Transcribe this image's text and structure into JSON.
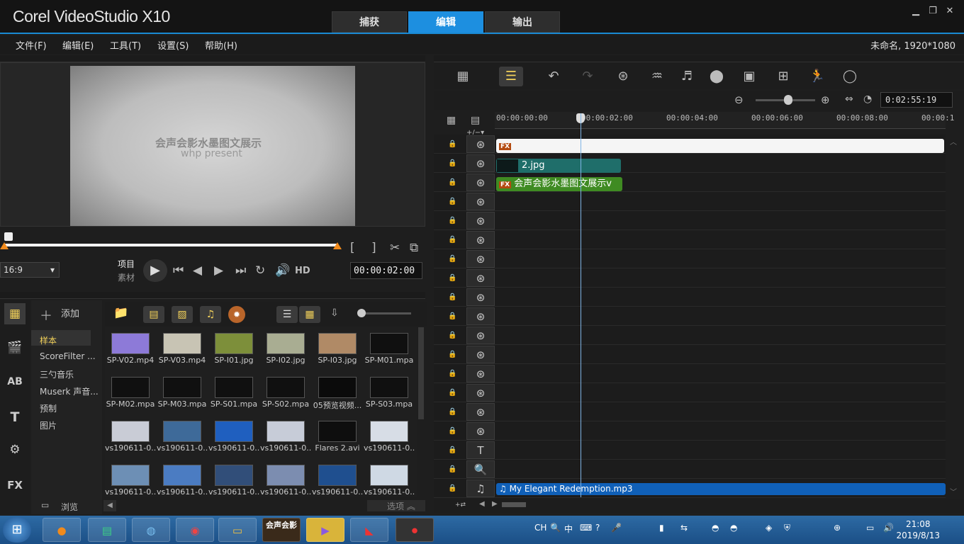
{
  "app": {
    "logo": "Corel VideoStudio X10",
    "mode_tabs": [
      "捕获",
      "编辑",
      "输出"
    ],
    "active_mode": "编辑",
    "window_controls": [
      "minimize-icon",
      "restore-icon",
      "close-icon"
    ]
  },
  "menu": {
    "items": [
      "文件(F)",
      "编辑(E)",
      "工具(T)",
      "设置(S)",
      "帮助(H)"
    ],
    "project_info": "未命名, 1920*1080"
  },
  "preview": {
    "overlay_line1": "会声会影水墨图文展示",
    "overlay_line2": "whp present",
    "aspect": "16:9",
    "mode_project": "项目",
    "mode_clip": "素材",
    "hd_label": "HD",
    "timecode": "00:00:02:00"
  },
  "library": {
    "add_label": "添加",
    "folders": [
      "样本",
      "ScoreFilter ...",
      "三勺音乐",
      "Muserk 声音...",
      "预制",
      "图片"
    ],
    "active_folder": "样本",
    "browse_label": "浏览",
    "options_label": "选项",
    "side_icons": [
      "media-icon",
      "instant-project-icon",
      "title-icon",
      "text-icon",
      "transition-icon",
      "fx-icon"
    ],
    "side_icon_text": {
      "ab": "AB",
      "t": "T",
      "fx": "FX"
    },
    "items": [
      {
        "name": "SP-V02.mp4",
        "color": "#8d7ad8"
      },
      {
        "name": "SP-V03.mp4",
        "color": "#c8c4b4"
      },
      {
        "name": "SP-I01.jpg",
        "color": "#7d8f3a"
      },
      {
        "name": "SP-I02.jpg",
        "color": "#a9ad92"
      },
      {
        "name": "SP-I03.jpg",
        "color": "#b08a66"
      },
      {
        "name": "SP-M01.mpa",
        "color": "#101010"
      },
      {
        "name": "SP-M02.mpa",
        "color": "#101010"
      },
      {
        "name": "SP-M03.mpa",
        "color": "#101010"
      },
      {
        "name": "SP-S01.mpa",
        "color": "#101010"
      },
      {
        "name": "SP-S02.mpa",
        "color": "#101010"
      },
      {
        "name": "05预览视频...",
        "color": "#0b0b0b"
      },
      {
        "name": "SP-S03.mpa",
        "color": "#101010"
      },
      {
        "name": "vs190611-0...",
        "color": "#c9ccd6"
      },
      {
        "name": "vs190611-0...",
        "color": "#3e6a99"
      },
      {
        "name": "vs190611-0...",
        "color": "#1f5fbf"
      },
      {
        "name": "vs190611-0...",
        "color": "#c7ccd8"
      },
      {
        "name": "Flares 2.avi",
        "color": "#0e0e0e"
      },
      {
        "name": "vs190611-0...",
        "color": "#d7dde6"
      },
      {
        "name": "vs190611-0...",
        "color": "#6d8fb5"
      },
      {
        "name": "vs190611-0...",
        "color": "#4b7cc2"
      },
      {
        "name": "vs190611-0...",
        "color": "#314e79"
      },
      {
        "name": "vs190611-0...",
        "color": "#7c8db0"
      },
      {
        "name": "vs190611-0...",
        "color": "#1f4f8f"
      },
      {
        "name": "vs190611-0...",
        "color": "#cfd9e4"
      }
    ]
  },
  "timeline": {
    "timecode": "0:02:55:19",
    "ruler": [
      "00:00:00:00",
      "00:00:02:00",
      "00:00:04:00",
      "00:00:06:00",
      "00:00:08:00",
      "00:00:1"
    ],
    "clips": {
      "overlay_fx_label": "FX",
      "image_clip": "2.jpg",
      "title_clip": "会声会影水墨图文展示v",
      "music_clip": "My Elegant Redemption.mp3"
    },
    "track_icons": {
      "title": "T",
      "voice": "🔍",
      "music": "♫"
    }
  },
  "taskbar": {
    "apps": [
      "",
      "",
      "",
      "",
      "",
      "会声会影",
      "",
      "",
      ""
    ],
    "tray_lang": "CH",
    "tray_ime": "中",
    "time": "21:08",
    "date": "2019/8/13"
  },
  "colors": {
    "accent": "#1d8fe0",
    "clip_teal": "#1f6e6a",
    "clip_green": "#3f8b22",
    "clip_blue": "#1060b8"
  }
}
